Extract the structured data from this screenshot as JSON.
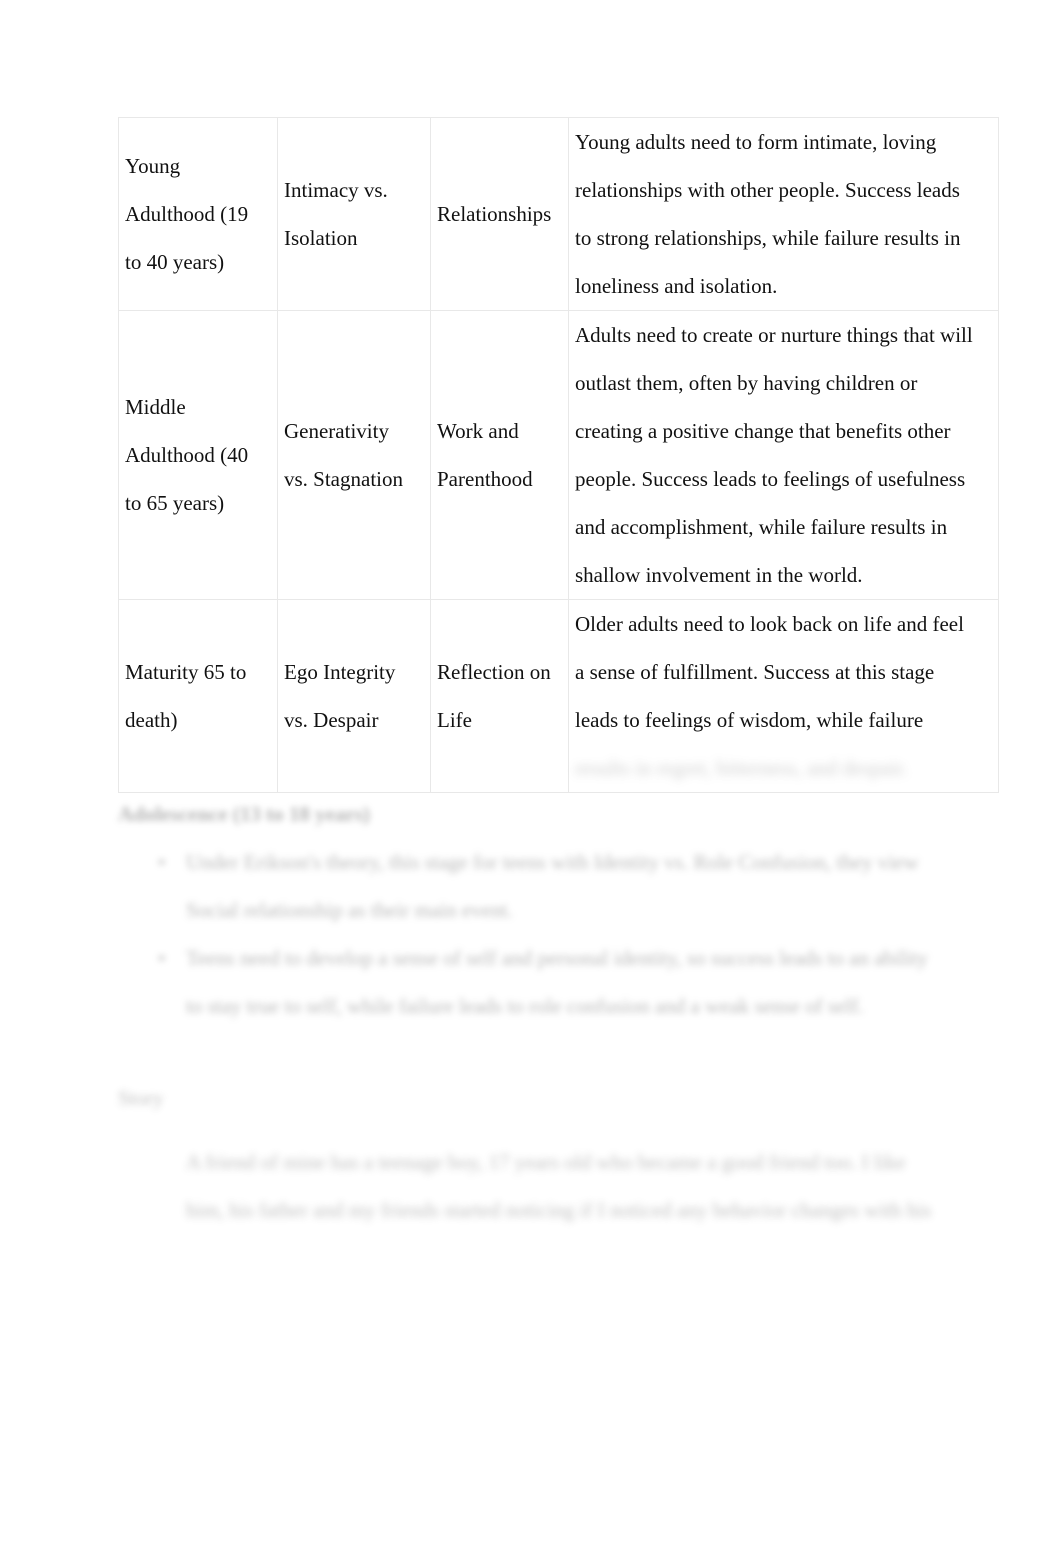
{
  "document": {
    "table": {
      "rows": [
        {
          "stage": "Young Adulthood (19 to 40 years)",
          "stage_lines": [
            "Young",
            "Adulthood (19",
            "to 40 years)"
          ],
          "crisis": "Intimacy vs. Isolation",
          "crisis_lines": [
            "Intimacy vs.",
            "Isolation"
          ],
          "event": "Relationships",
          "event_lines": [
            "Relationships"
          ],
          "description": "Young adults need to form intimate, loving relationships with other people. Success leads to strong relationships, while failure results in loneliness and isolation.",
          "description_lines": [
            "Young adults need to form intimate, loving",
            "relationships with other people. Success leads",
            "to strong relationships, while failure results in",
            "loneliness and isolation."
          ]
        },
        {
          "stage": "Middle Adulthood (40 to 65 years)",
          "stage_lines": [
            "Middle",
            "Adulthood (40",
            "to 65 years)"
          ],
          "crisis": "Generativity vs. Stagnation",
          "crisis_lines": [
            "Generativity",
            "vs. Stagnation"
          ],
          "event": "Work and Parenthood",
          "event_lines": [
            "Work and",
            "Parenthood"
          ],
          "description": "Adults need to create or nurture things that will outlast them, often by having children or creating a positive change that benefits other people. Success leads to feelings of usefulness and accomplishment, while failure results in shallow involvement in the world.",
          "description_lines": [
            "Adults need to create or nurture things that will",
            "outlast them, often by having children or",
            "creating a positive change that benefits other",
            "people. Success leads to feelings of usefulness",
            "and accomplishment, while failure results in",
            "shallow involvement in the world."
          ]
        },
        {
          "stage": "Maturity 65 to death)",
          "stage_lines": [
            "Maturity 65 to",
            "death)"
          ],
          "crisis": "Ego Integrity vs. Despair",
          "crisis_lines": [
            "Ego Integrity",
            "vs. Despair"
          ],
          "event": "Reflection on Life",
          "event_lines": [
            "Reflection on",
            "Life"
          ],
          "description": "Older adults need to look back on life and feel a sense of fulfillment. Success at this stage leads to feelings of wisdom, while failure results in regret, bitterness, and despair.",
          "description_lines": [
            "Older adults need to look back on life and feel",
            "a sense of fulfillment. Success at this stage",
            "leads to feelings of wisdom, while failure"
          ],
          "description_last_line": "results in regret, bitterness, and despair."
        }
      ]
    },
    "below_table": {
      "heading": "Adolescence (13 to 18 years)",
      "bullets": [
        {
          "marker": "•",
          "lines": [
            "Under Erikson's theory, this stage for teens with Identity vs. Role Confusion, they view",
            "Social relationship as their main event."
          ]
        },
        {
          "marker": "•",
          "lines": [
            "Teens need to develop a sense of self and personal identity, so success leads to an ability",
            "to stay true to self, while failure leads to role confusion and a weak sense of self."
          ]
        }
      ],
      "story_label": "Story",
      "story_lines": [
        "A friend of mine has a teenage boy, 17 years old who became a good friend too. I like",
        "him, his father and my friends started noticing if I noticed any behavior changes with his"
      ]
    }
  }
}
